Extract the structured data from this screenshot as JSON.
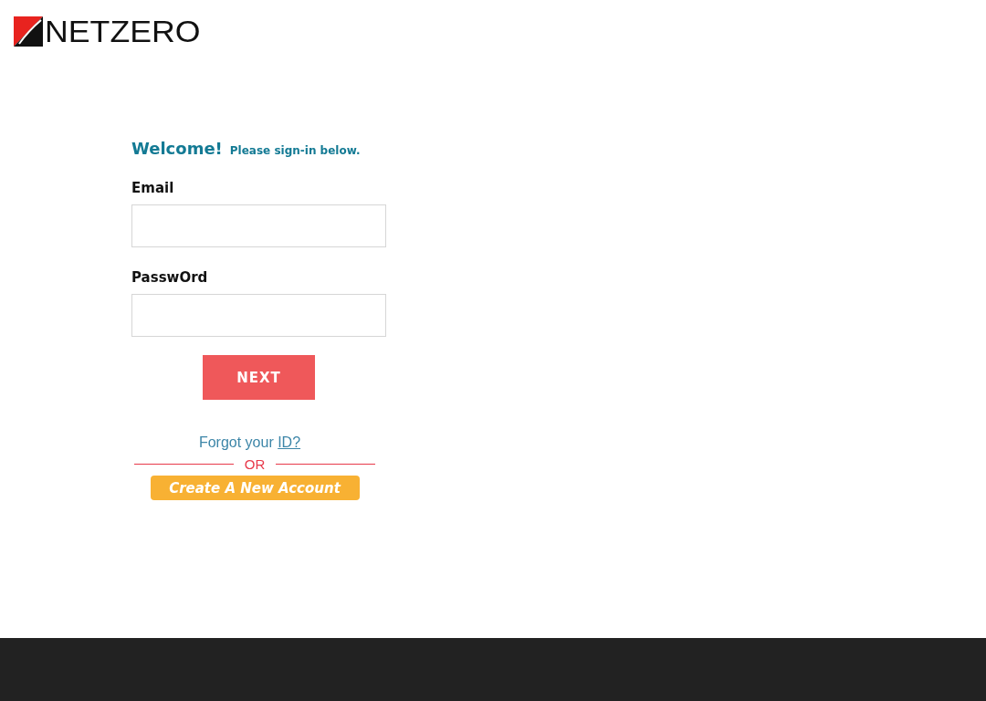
{
  "logo": {
    "text": "NETZERO"
  },
  "greeting": {
    "title": "Welcome!",
    "subtitle": "Please sign-in below."
  },
  "fields": [
    {
      "label": "Email"
    },
    {
      "label": "PasswOrd"
    }
  ],
  "next_button": "NEXT",
  "forgot": {
    "text": "Forgot your",
    "link": "ID?"
  },
  "separator": "OR",
  "create_button": "Create A New Account"
}
